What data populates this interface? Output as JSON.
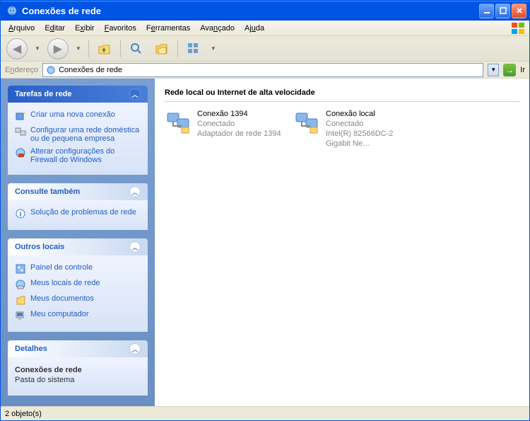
{
  "titlebar": {
    "text": "Conexões de rede"
  },
  "menus": {
    "arquivo": "Arquivo",
    "editar": "Editar",
    "exibir": "Exibir",
    "favoritos": "Favoritos",
    "ferramentas": "Ferramentas",
    "avancado": "Avançado",
    "ajuda": "Ajuda"
  },
  "address": {
    "label": "Endereço",
    "value": "Conexões de rede",
    "go": "Ir"
  },
  "sidebar": {
    "tasks": {
      "title": "Tarefas de rede",
      "items": [
        "Criar uma nova conexão",
        "Configurar uma rede doméstica ou de pequena empresa",
        "Alterar configurações do Firewall do Windows"
      ]
    },
    "see_also": {
      "title": "Consulte também",
      "items": [
        "Solução de problemas de rede"
      ]
    },
    "other": {
      "title": "Outros locais",
      "items": [
        "Painel de controle",
        "Meus locais de rede",
        "Meus documentos",
        "Meu computador"
      ]
    },
    "details": {
      "title": "Detalhes",
      "name": "Conexões de rede",
      "type": "Pasta do sistema"
    }
  },
  "main": {
    "group": "Rede local ou Internet de alta velocidade",
    "conn1": {
      "name": "Conexão 1394",
      "status": "Conectado",
      "device": "Adaptador de rede 1394"
    },
    "conn2": {
      "name": "Conexão local",
      "status": "Conectado",
      "device": "Intel(R) 82566DC-2 Gigabit Ne…"
    }
  },
  "statusbar": {
    "text": "2 objeto(s)"
  }
}
